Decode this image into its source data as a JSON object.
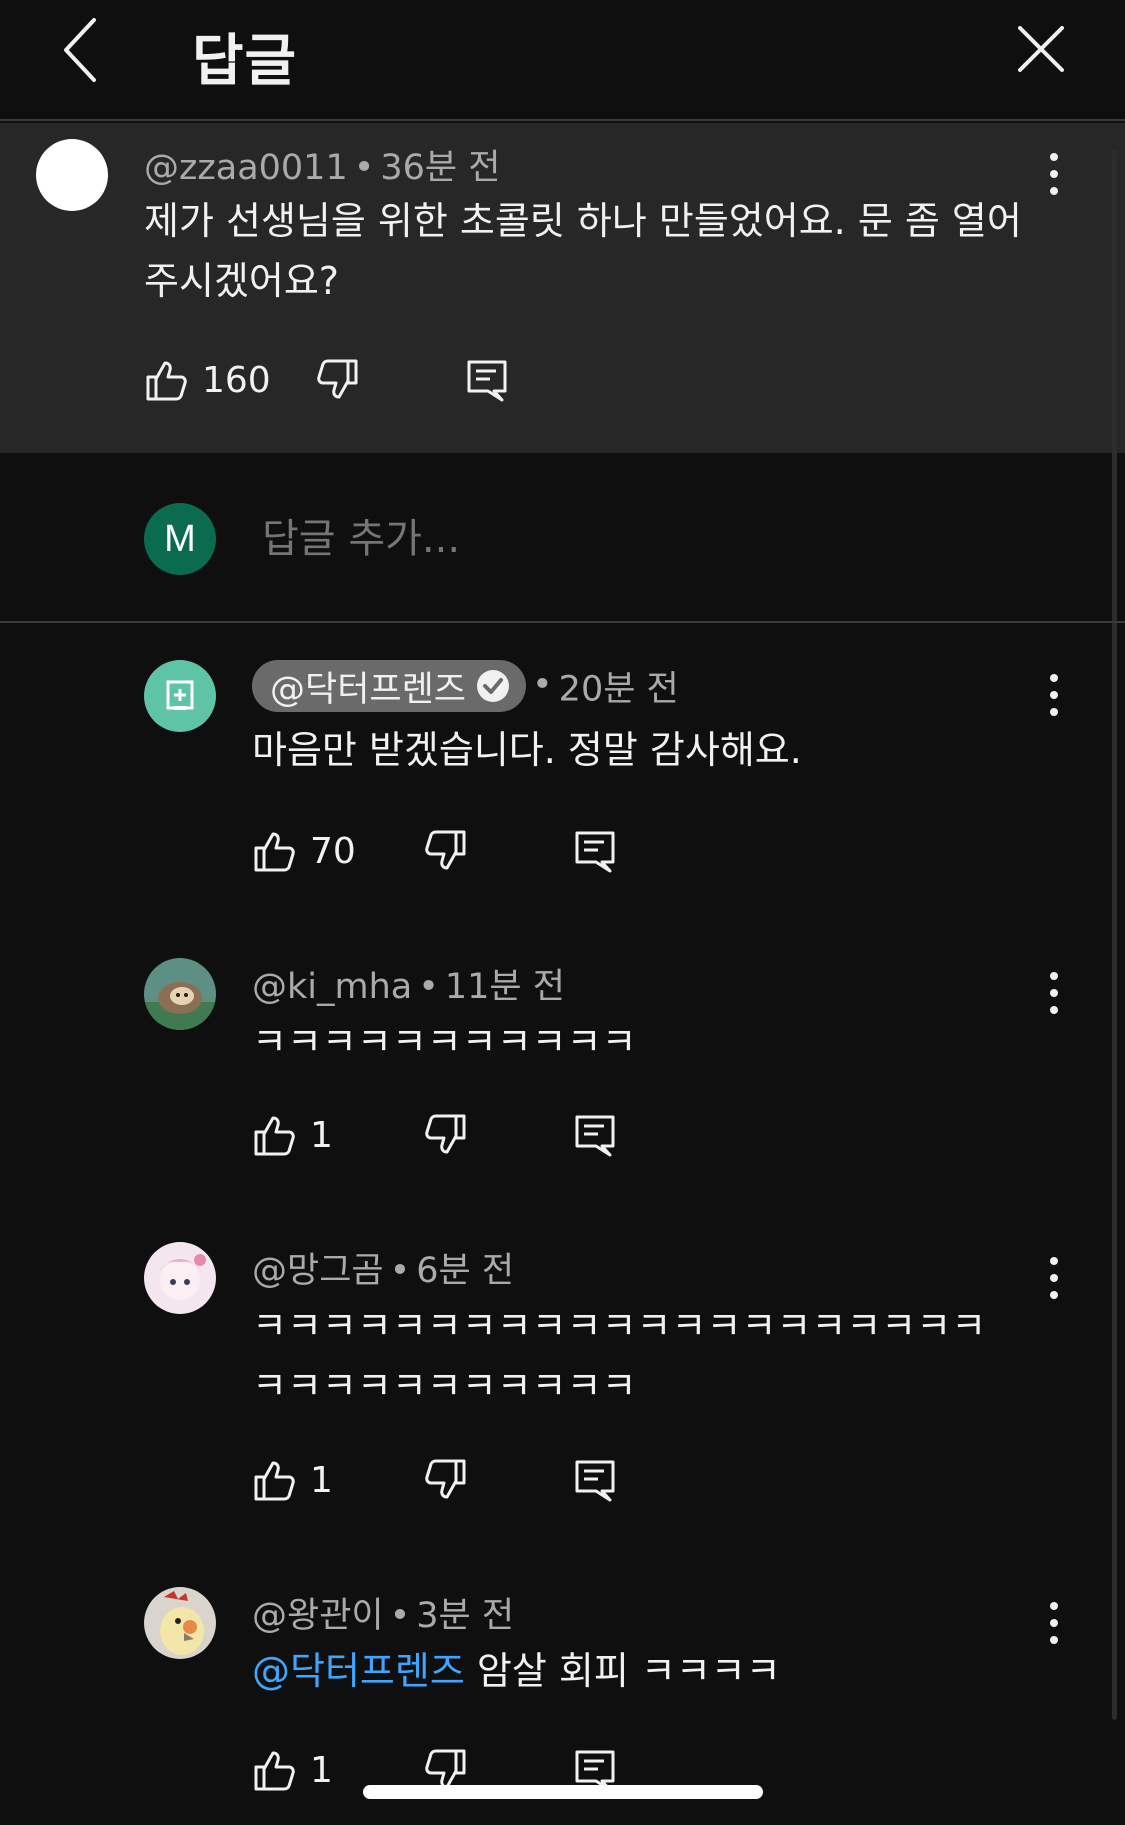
{
  "header": {
    "title": "답글"
  },
  "parent_comment": {
    "handle": "@zzaa0011",
    "time": "36분 전",
    "text": "제가 선생님을 위한 초콜릿 하나 만들었어요. 문 좀 열어주시겠어요?",
    "likes": "160",
    "avatar_color": "#ffffff"
  },
  "reply_box": {
    "avatar_letter": "M",
    "placeholder": "답글 추가..."
  },
  "replies": [
    {
      "handle": "@닥터프렌즈",
      "verified": true,
      "time": "20분 전",
      "text": "마음만 받겠습니다. 정말 감사해요.",
      "likes": "70",
      "avatar_icon": "medical-plus-icon",
      "avatar_color": "#5ec4a5"
    },
    {
      "handle": "@ki_mha",
      "time": "11분 전",
      "text": "ㅋㅋㅋㅋㅋㅋㅋㅋㅋㅋㅋ",
      "likes": "1"
    },
    {
      "handle": "@망그곰",
      "time": "6분 전",
      "text_line1": "ㅋㅋㅋㅋㅋㅋㅋㅋㅋㅋㅋㅋㅋㅋㅋㅋㅋㅋㅋㅋㅋ",
      "text_line2": "ㅋㅋㅋㅋㅋㅋㅋㅋㅋㅋㅋ",
      "likes": "1"
    },
    {
      "handle": "@왕관이",
      "time": "3분 전",
      "mention": "@닥터프렌즈",
      "text": " 암살 회피 ㅋㅋㅋㅋ",
      "likes": "1"
    }
  ],
  "separator": "•",
  "colors": {
    "background": "#0f0f0f",
    "highlight": "#272727",
    "secondary_text": "#aaaaaa",
    "mention": "#3ea6ff",
    "chip": "#6a6a6a"
  }
}
